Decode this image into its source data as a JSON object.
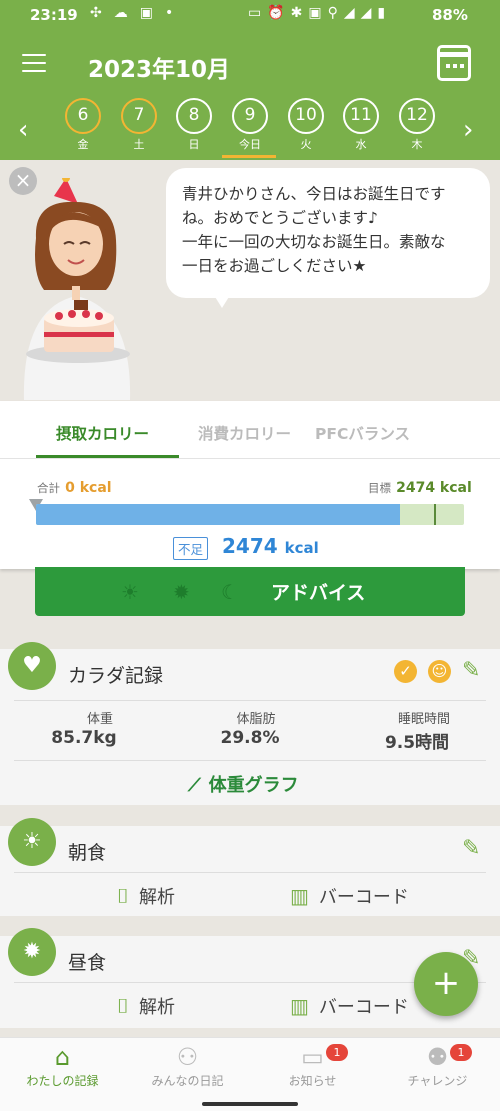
{
  "status_bar": {
    "time": "23:19",
    "battery": "88%"
  },
  "header": {
    "title": "2023年10月"
  },
  "days": [
    {
      "num": "6",
      "label": "金",
      "past": true
    },
    {
      "num": "7",
      "label": "土",
      "past": true
    },
    {
      "num": "8",
      "label": "日",
      "past": false
    },
    {
      "num": "9",
      "label": "今日",
      "past": false
    },
    {
      "num": "10",
      "label": "火",
      "past": false
    },
    {
      "num": "11",
      "label": "水",
      "past": false
    },
    {
      "num": "12",
      "label": "木",
      "past": false
    }
  ],
  "message": {
    "line1": "青井ひかりさん、今日はお誕生日です",
    "line2": "ね。おめでとうございます♪",
    "line3": "一年に一回の大切なお誕生日。素敵な",
    "line4": "一日をお過ごしください★"
  },
  "tabs": [
    "摂取カロリー",
    "消費カロリー",
    "PFCバランス"
  ],
  "calorie": {
    "total_label": "合計",
    "total_value": "0 kcal",
    "goal_label": "目標",
    "goal_value": "2474 kcal",
    "short_label": "不足",
    "short_value": "2474",
    "short_unit": "kcal",
    "fill_fraction": 0.85,
    "goal_fraction": 0.93
  },
  "advice": {
    "label": "アドバイス"
  },
  "body_record": {
    "title": "カラダ記録",
    "stats": [
      {
        "label": "体重",
        "value": "85.7kg"
      },
      {
        "label": "体脂肪",
        "value": "29.8%"
      },
      {
        "label": "睡眠時間",
        "value": "9.5時間"
      }
    ],
    "graph_link": "体重グラフ"
  },
  "meals": [
    {
      "title": "朝食",
      "analyze": "解析",
      "barcode": "バーコード"
    },
    {
      "title": "昼食",
      "analyze": "解析",
      "barcode": "バーコード"
    }
  ],
  "nav": [
    {
      "label": "わたしの記録",
      "icon": "home-icon",
      "badge": ""
    },
    {
      "label": "みんなの日記",
      "icon": "people-icon",
      "badge": ""
    },
    {
      "label": "お知らせ",
      "icon": "chat-icon",
      "badge": "1"
    },
    {
      "label": "チャレンジ",
      "icon": "medal-icon",
      "badge": "1"
    }
  ],
  "colors": {
    "brand": "#7ab04a",
    "accent": "#2d9a3c",
    "warning": "#f3b533",
    "progress": "#6fb1e7"
  }
}
